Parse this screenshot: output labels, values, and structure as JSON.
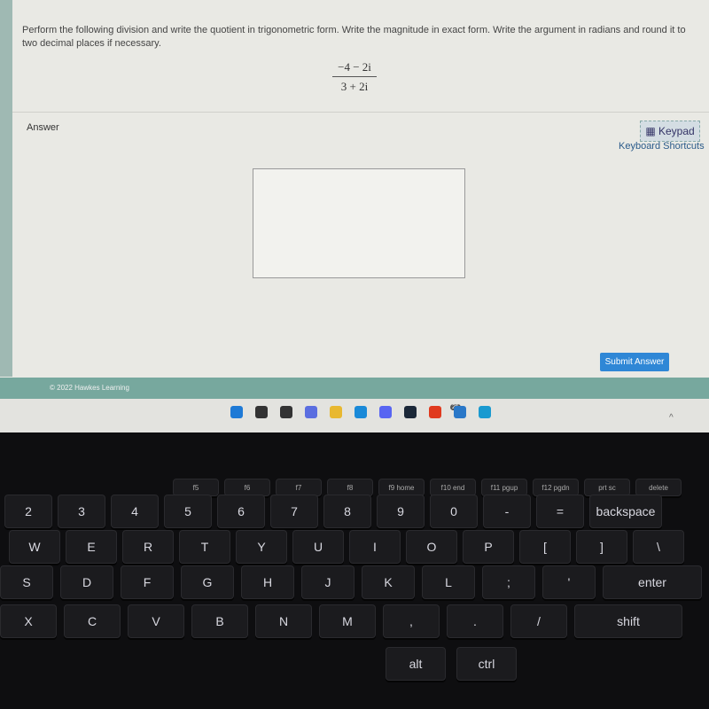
{
  "question": {
    "text": "Perform the following division and write the quotient in trigonometric form. Write the magnitude in exact form. Write the argument in radians and round it to two decimal places if necessary.",
    "numerator": "−4 − 2i",
    "denominator": "3 + 2i"
  },
  "answer": {
    "label": "Answer",
    "keypad_label": "Keypad",
    "shortcuts_label": "Keyboard Shortcuts",
    "value": ""
  },
  "submit_label": "Submit Answer",
  "footer": {
    "copyright": "© 2022 Hawkes Learning"
  },
  "taskbar": {
    "icons": [
      "windows-start",
      "search",
      "task-view",
      "chat",
      "file-explorer",
      "edge",
      "discord",
      "steam",
      "office",
      "mail",
      "edge-beta"
    ],
    "mail_badge": "25",
    "tray": "^"
  },
  "keyboard": {
    "fn_row": [
      "f5",
      "f6",
      "f7",
      "f8",
      "f9 home",
      "f10 end",
      "f11 pgup",
      "f12 pgdn",
      "prt sc",
      "delete"
    ],
    "num_row": [
      "2",
      "3",
      "4",
      "5",
      "6",
      "7",
      "8",
      "9",
      "0",
      "-",
      "=",
      "backspace"
    ],
    "top_row": [
      "W",
      "E",
      "R",
      "T",
      "Y",
      "U",
      "I",
      "O",
      "P",
      "[",
      "]",
      "\\"
    ],
    "home_row": [
      "S",
      "D",
      "F",
      "G",
      "H",
      "J",
      "K",
      "L",
      ";",
      "'",
      "enter"
    ],
    "bottom_row": [
      "X",
      "C",
      "V",
      "B",
      "N",
      "M",
      ",",
      ".",
      "/",
      "shift"
    ],
    "space_row": [
      "alt",
      "ctrl"
    ]
  },
  "colors": {
    "accent": "#2f87d6",
    "footer": "#77a89e"
  }
}
